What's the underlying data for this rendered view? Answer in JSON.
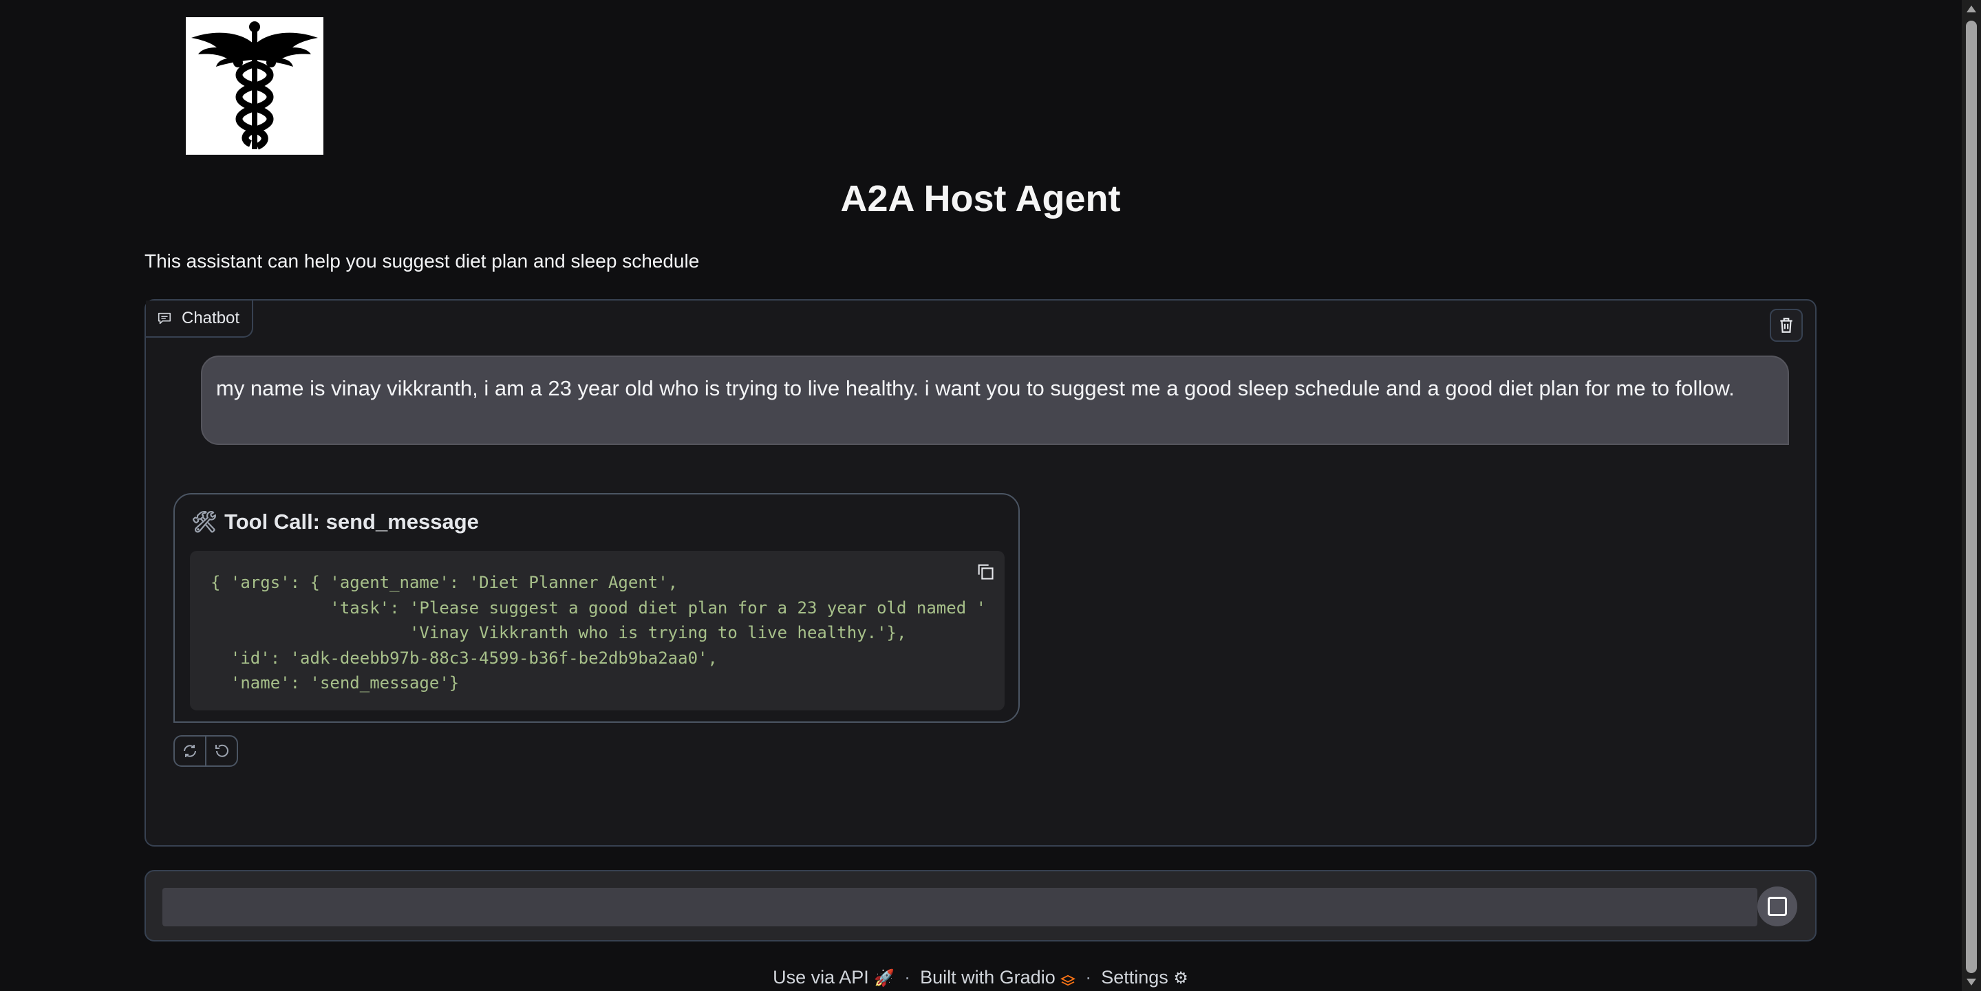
{
  "header": {
    "logo_icon": "caduceus-icon",
    "title": "A2A Host Agent",
    "description": "This assistant can help you suggest diet plan and sleep schedule"
  },
  "chatbot": {
    "label": "Chatbot",
    "label_icon": "chat-bubble-icon",
    "clear_icon": "trash-icon",
    "messages": [
      {
        "role": "user",
        "text": "my name is vinay vikkranth, i am a 23 year old who is trying to live healthy. i want you to suggest me a good sleep schedule and a good diet plan for me to follow."
      },
      {
        "role": "assistant",
        "tool_icon": "🛠",
        "tool_title": "Tool Call: send_message",
        "code": "{ 'args': { 'agent_name': 'Diet Planner Agent',\n            'task': 'Please suggest a good diet plan for a 23 year old named '\n                    'Vinay Vikkranth who is trying to live healthy.'},\n  'id': 'adk-deebb97b-88c3-4599-b36f-be2db9ba2aa0',\n  'name': 'send_message'}"
      }
    ],
    "actions": [
      "retry-icon",
      "undo-icon"
    ]
  },
  "input": {
    "value": "",
    "placeholder": "",
    "stop_icon": "stop-icon"
  },
  "footer": {
    "api_label": "Use via API",
    "api_emoji": "🚀",
    "separator": "·",
    "gradio_label": "Built with Gradio",
    "gradio_emoji": "🟧",
    "settings_label": "Settings",
    "settings_emoji": "⚙"
  },
  "colors": {
    "background": "#0f0f11",
    "panel": "#18181b",
    "user_bubble": "#46464e",
    "code_text": "#a7c08a"
  }
}
